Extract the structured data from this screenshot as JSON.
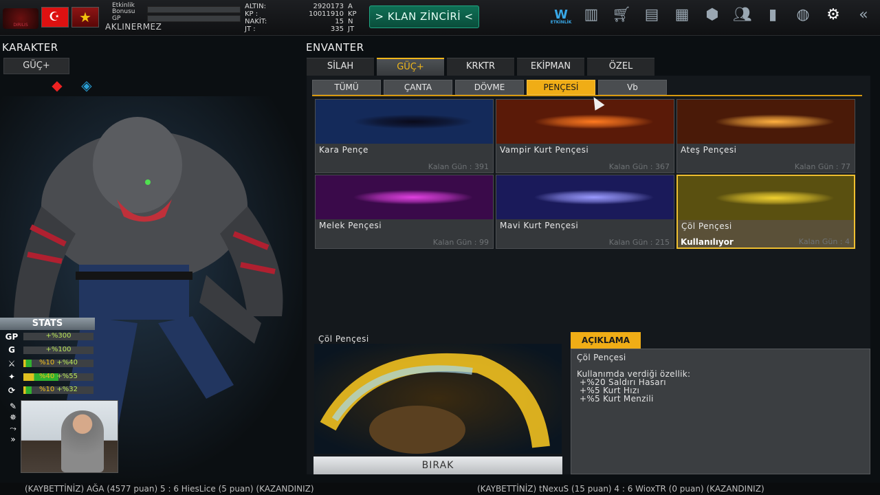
{
  "topbar": {
    "logo_text": "DIRILIS",
    "bonus_label_1": "Etkinlik",
    "bonus_label_2": "Bonusu",
    "gp_label": "GP",
    "username": "AKLINERMEZ",
    "currencies": [
      {
        "label": "ALTIN:",
        "value": "2920173",
        "unit": "A"
      },
      {
        "label": "KP   :",
        "value": "10011910",
        "unit": "KP"
      },
      {
        "label": "NAKİT:",
        "value": "15",
        "unit": "N"
      },
      {
        "label": "JT   :",
        "value": "335",
        "unit": "JT"
      }
    ],
    "klan_button": "> KLAN ZİNCİRİ <",
    "icons": [
      "etkinlik-icon",
      "buildings-icon",
      "cart-icon",
      "chest-icon",
      "columns-icon",
      "box-icon",
      "users-icon",
      "chart-icon",
      "globe-icon",
      "gear-icon",
      "back-icon"
    ],
    "etkinlik_text": "ETKİNLİK"
  },
  "character": {
    "title": "KARAKTER",
    "tab": "GÜÇ+",
    "stats_title": "STATS",
    "stats": [
      {
        "icon": "GP",
        "text": "+%300",
        "yellow": "",
        "fill": 0,
        "fill_color": "#30b030"
      },
      {
        "icon": "G",
        "text": "+%100",
        "yellow": "",
        "fill": 0,
        "fill_color": "#30b030"
      },
      {
        "icon": "⚔",
        "text": "+%40",
        "yellow": "%10",
        "fill": 0.12,
        "fill_color": "#30b030"
      },
      {
        "icon": "✦",
        "text": "+%55",
        "yellow": "%40",
        "fill": 0.5,
        "fill_color": "#30b030"
      },
      {
        "icon": "⟳",
        "text": "+%32",
        "yellow": "%10",
        "fill": 0.12,
        "fill_color": "#30b030"
      }
    ]
  },
  "inventory": {
    "title": "ENVANTER",
    "tabs": [
      "SİLAH",
      "GÜÇ+",
      "KRKTR",
      "EKİPMAN",
      "ÖZEL"
    ],
    "active_tab": 1,
    "subtabs": [
      "TÜMÜ",
      "ÇANTA",
      "DÖVME",
      "PENÇESİ",
      "Vb"
    ],
    "active_subtab": 3,
    "items": [
      {
        "name": "Kara Pençe",
        "days": "Kalan Gün : 391",
        "color": "#142a5a",
        "glow": "#0a0a1a",
        "in_use": ""
      },
      {
        "name": "Vampir Kurt Pençesi",
        "days": "Kalan Gün : 367",
        "color": "#5a1a08",
        "glow": "#ff7a20",
        "in_use": ""
      },
      {
        "name": "Ateş Pençesi",
        "days": "Kalan Gün : 77",
        "color": "#4a1a08",
        "glow": "#ffb040",
        "in_use": ""
      },
      {
        "name": "Melek Pençesi",
        "days": "Kalan Gün : 99",
        "color": "#3a0a4a",
        "glow": "#e040e0",
        "in_use": ""
      },
      {
        "name": "Mavi Kurt Pençesi",
        "days": "Kalan Gün : 215",
        "color": "#1a1a5a",
        "glow": "#9a9aff",
        "in_use": ""
      },
      {
        "name": "Çöl Pençesi",
        "days": "Kalan Gün : 4",
        "color": "#5a5010",
        "glow": "#f0d030",
        "in_use": "Kullanılıyor"
      }
    ],
    "preview_title": "Çöl Pençesi",
    "release_button": "BIRAK",
    "description_tab": "AÇIKLAMA",
    "description": {
      "name": "Çöl Pençesi",
      "intro": "Kullanımda verdiği özellik:",
      "lines": [
        "+%20 Saldırı Hasarı",
        "+%5 Kurt Hızı",
        "+%5 Kurt Menzili"
      ]
    }
  },
  "ticker": {
    "left": "(KAYBETTİNİZ) AĞA (4577 puan) 5 : 6 HiesLice (5 puan) (KAZANDINIZ)",
    "right": "(KAYBETTİNİZ) tNexuS (15 puan) 4 : 6 WioxTR (0 puan) (KAZANDINIZ)"
  }
}
